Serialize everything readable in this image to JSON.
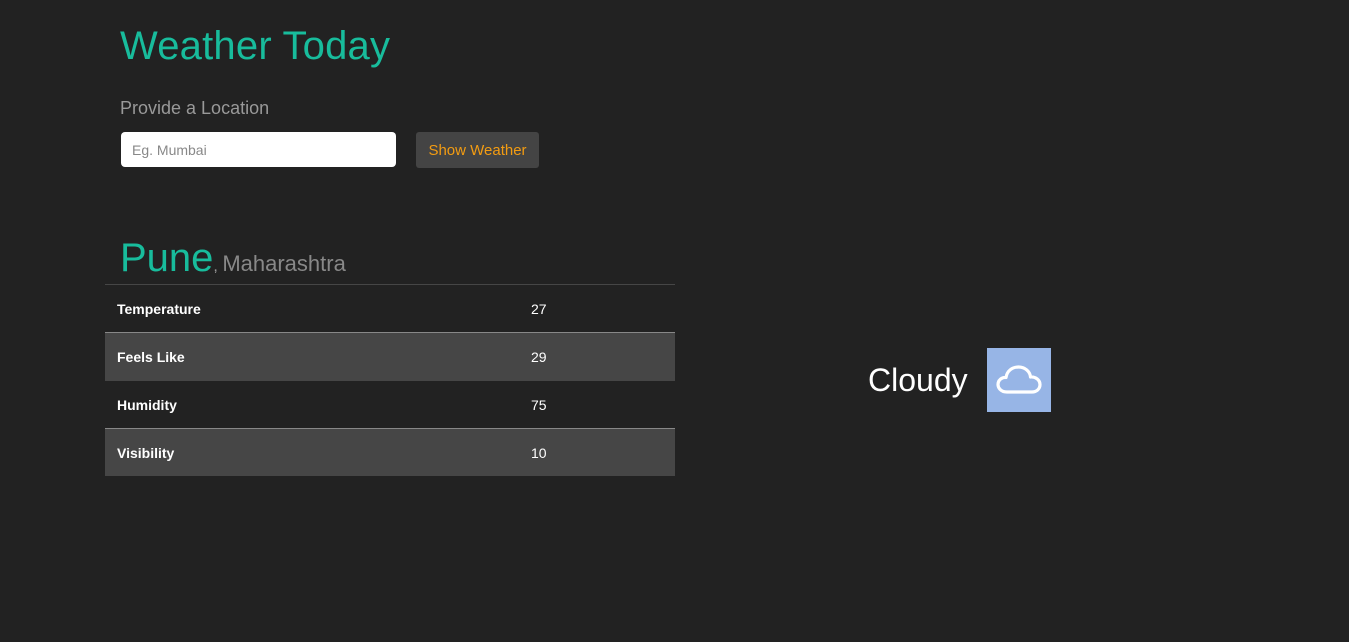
{
  "app": {
    "title": "Weather Today"
  },
  "search": {
    "label": "Provide a Location",
    "placeholder": "Eg. Mumbai",
    "value": "",
    "button_label": "Show Weather"
  },
  "location": {
    "city": "Pune",
    "separator": ",",
    "state": "Maharashtra"
  },
  "metrics": [
    {
      "label": "Temperature",
      "value": "27"
    },
    {
      "label": "Feels Like",
      "value": "29"
    },
    {
      "label": "Humidity",
      "value": "75"
    },
    {
      "label": "Visibility",
      "value": "10"
    }
  ],
  "condition": {
    "text": "Cloudy",
    "icon": "cloud-icon",
    "icon_bg": "#97b5e6"
  },
  "colors": {
    "background": "#222222",
    "accent": "#18bc9c",
    "button_text": "#f39c12",
    "muted": "#999999"
  }
}
